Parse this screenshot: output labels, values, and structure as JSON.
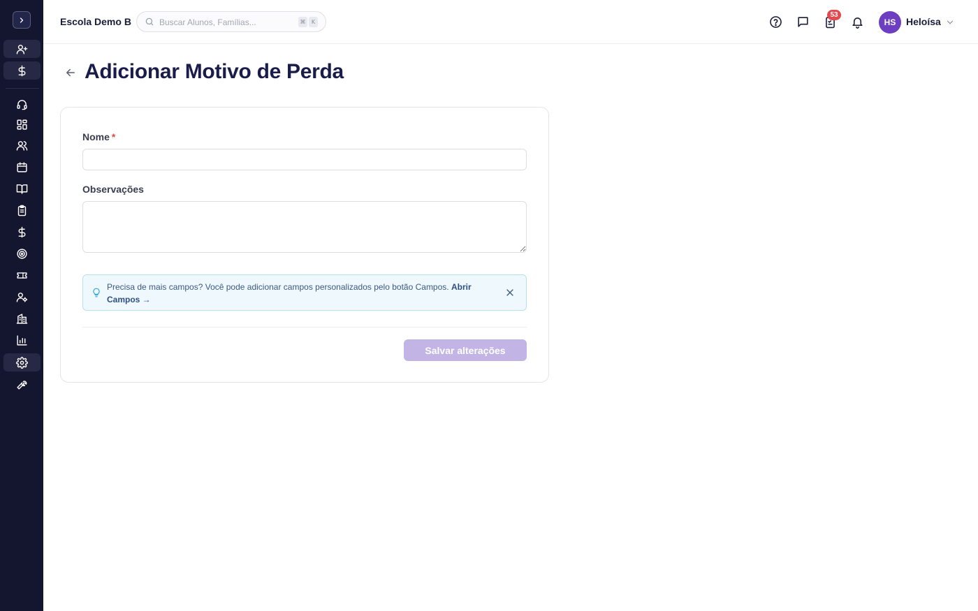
{
  "app": {
    "school_name": "Escola Demo B"
  },
  "search": {
    "placeholder": "Buscar Alunos, Famílias...",
    "shortcut_key1": "⌘",
    "shortcut_key2": "K"
  },
  "header": {
    "tasks_badge_count": "53",
    "user_initials": "HS",
    "user_name": "Heloísa"
  },
  "sidebar": {
    "items": [
      {
        "icon": "user-plus-icon"
      },
      {
        "icon": "dollar-icon"
      },
      {
        "icon": "headset-icon"
      },
      {
        "icon": "dashboard-icon"
      },
      {
        "icon": "users-icon"
      },
      {
        "icon": "calendar-icon"
      },
      {
        "icon": "book-icon"
      },
      {
        "icon": "clipboard-icon"
      },
      {
        "icon": "dollar-icon"
      },
      {
        "icon": "target-icon"
      },
      {
        "icon": "ticket-icon"
      },
      {
        "icon": "user-cog-icon"
      },
      {
        "icon": "building-icon"
      },
      {
        "icon": "bar-chart-icon"
      },
      {
        "icon": "gear-icon"
      },
      {
        "icon": "wrench-icon"
      }
    ]
  },
  "page": {
    "title": "Adicionar Motivo de Perda"
  },
  "form": {
    "name_label": "Nome",
    "name_required_mark": "*",
    "name_value": "",
    "notes_label": "Observações",
    "notes_value": "",
    "tip_text": "Precisa de mais campos? Você pode adicionar campos personalizados pelo botão Campos.",
    "tip_link": "Abrir Campos →",
    "save_label": "Salvar alterações"
  },
  "colors": {
    "sidebar_bg": "#14152e",
    "accent_purple": "#6d3fc0",
    "save_disabled": "#c3b4e6",
    "badge_red": "#e5484d",
    "tip_bg": "#eef8fd"
  }
}
